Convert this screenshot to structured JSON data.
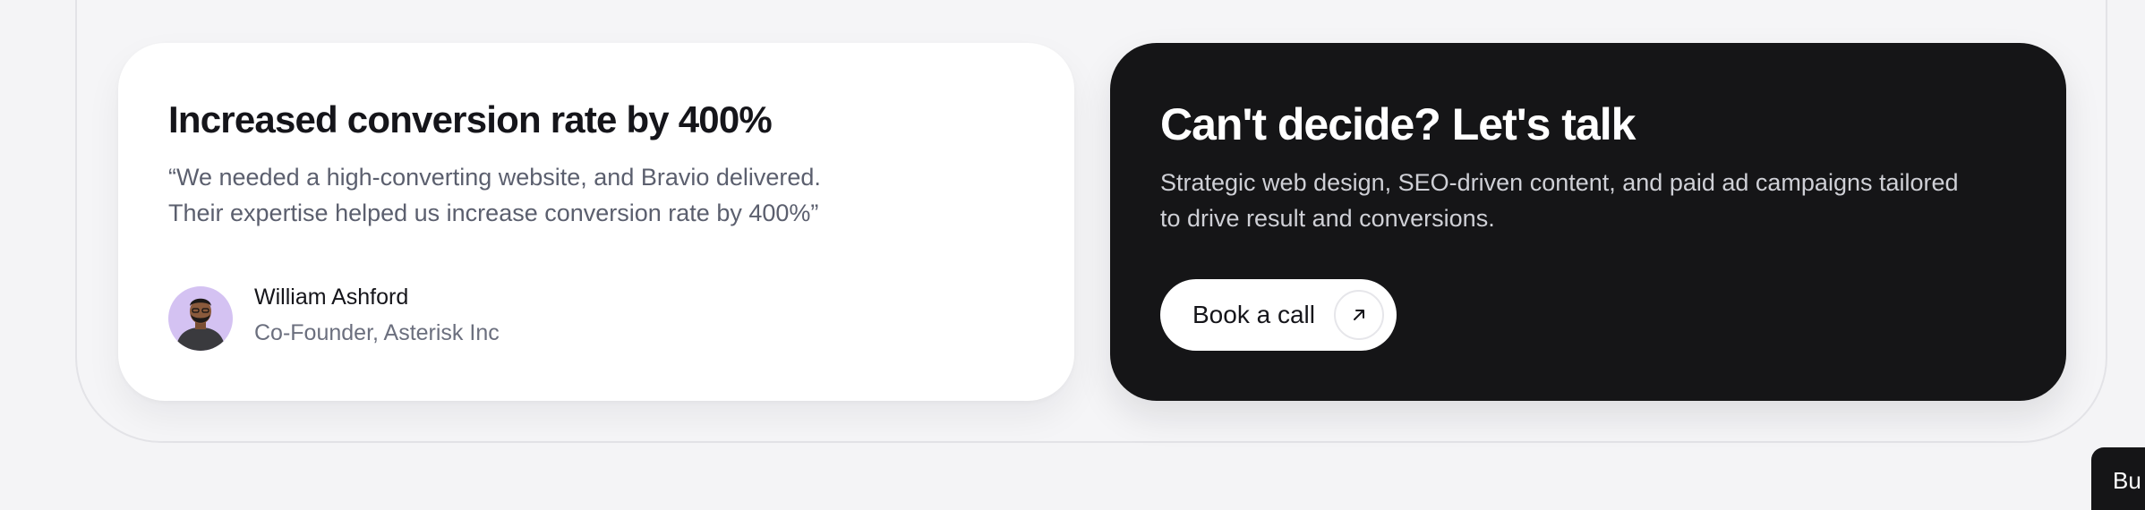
{
  "testimonial": {
    "title": "Increased conversion rate by 400%",
    "quote_line1": "“We needed a high-converting website, and Bravio delivered.",
    "quote_line2": "Their expertise helped us increase conversion rate by 400%”",
    "author_name": "William Ashford",
    "author_role": "Co-Founder, Asterisk Inc",
    "avatar_bg": "#d4c2f2"
  },
  "cta": {
    "title": "Can't decide? Let's talk",
    "desc_line1": "Strategic web design, SEO-driven content, and paid ad campaigns tailored",
    "desc_line2": "to drive result and conversions.",
    "button_label": "Book a call",
    "button_icon": "arrow-up-right-icon"
  },
  "corner_widget": {
    "label": "Bu"
  },
  "colors": {
    "dark_card": "#151517",
    "page_bg": "#f4f4f6",
    "muted_text": "#5b5f6e"
  }
}
